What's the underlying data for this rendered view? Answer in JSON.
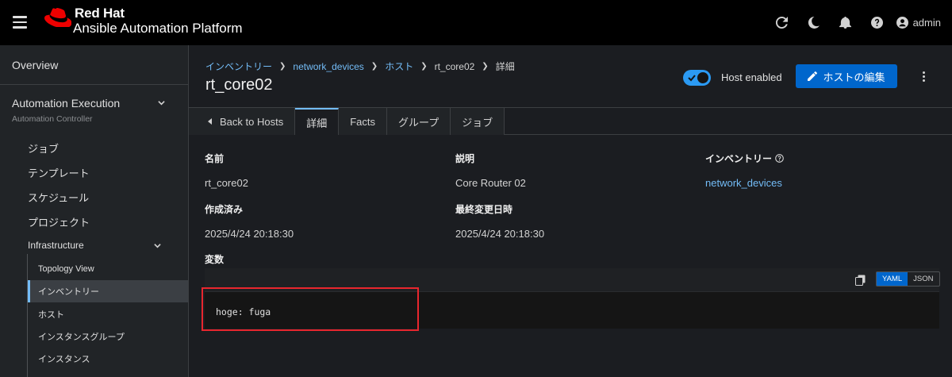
{
  "brand": {
    "line1": "Red Hat",
    "line2": "Ansible Automation Platform"
  },
  "masthead": {
    "user": "admin",
    "icons": [
      "refresh-icon",
      "moon-icon",
      "bell-icon",
      "help-icon",
      "user-icon"
    ]
  },
  "sidebar": {
    "overview": "Overview",
    "group": {
      "title": "Automation Execution",
      "subtitle": "Automation Controller"
    },
    "items": [
      "ジョブ",
      "テンプレート",
      "スケジュール",
      "プロジェクト"
    ],
    "infrastructure": "Infrastructure",
    "sub_items": [
      "Topology View",
      "インベントリー",
      "ホスト",
      "インスタンスグループ",
      "インスタンス"
    ],
    "active_sub": "インベントリー"
  },
  "breadcrumb": {
    "c1": "インベントリー",
    "c2": "network_devices",
    "c3": "ホスト",
    "c4": "rt_core02",
    "c5": "詳細"
  },
  "page": {
    "title": "rt_core02",
    "toggle_label": "Host enabled",
    "edit_label": "ホストの編集"
  },
  "tabs": {
    "back": "Back to Hosts",
    "t1": "詳細",
    "t2": "Facts",
    "t3": "グループ",
    "t4": "ジョブ"
  },
  "details": {
    "name_label": "名前",
    "name_value": "rt_core02",
    "desc_label": "説明",
    "desc_value": "Core Router 02",
    "inv_label": "インベントリー",
    "inv_value": "network_devices",
    "created_label": "作成済み",
    "created_value": "2025/4/24 20:18:30",
    "modified_label": "最終変更日時",
    "modified_value": "2025/4/24 20:18:30",
    "vars_label": "変数"
  },
  "variables": {
    "yaml": "YAML",
    "json": "JSON",
    "code": "hoge: fuga"
  },
  "colors": {
    "accent": "#73bcf7",
    "primary": "#0066cc",
    "highlight": "#e8262e",
    "brand_red": "#ee0000"
  }
}
